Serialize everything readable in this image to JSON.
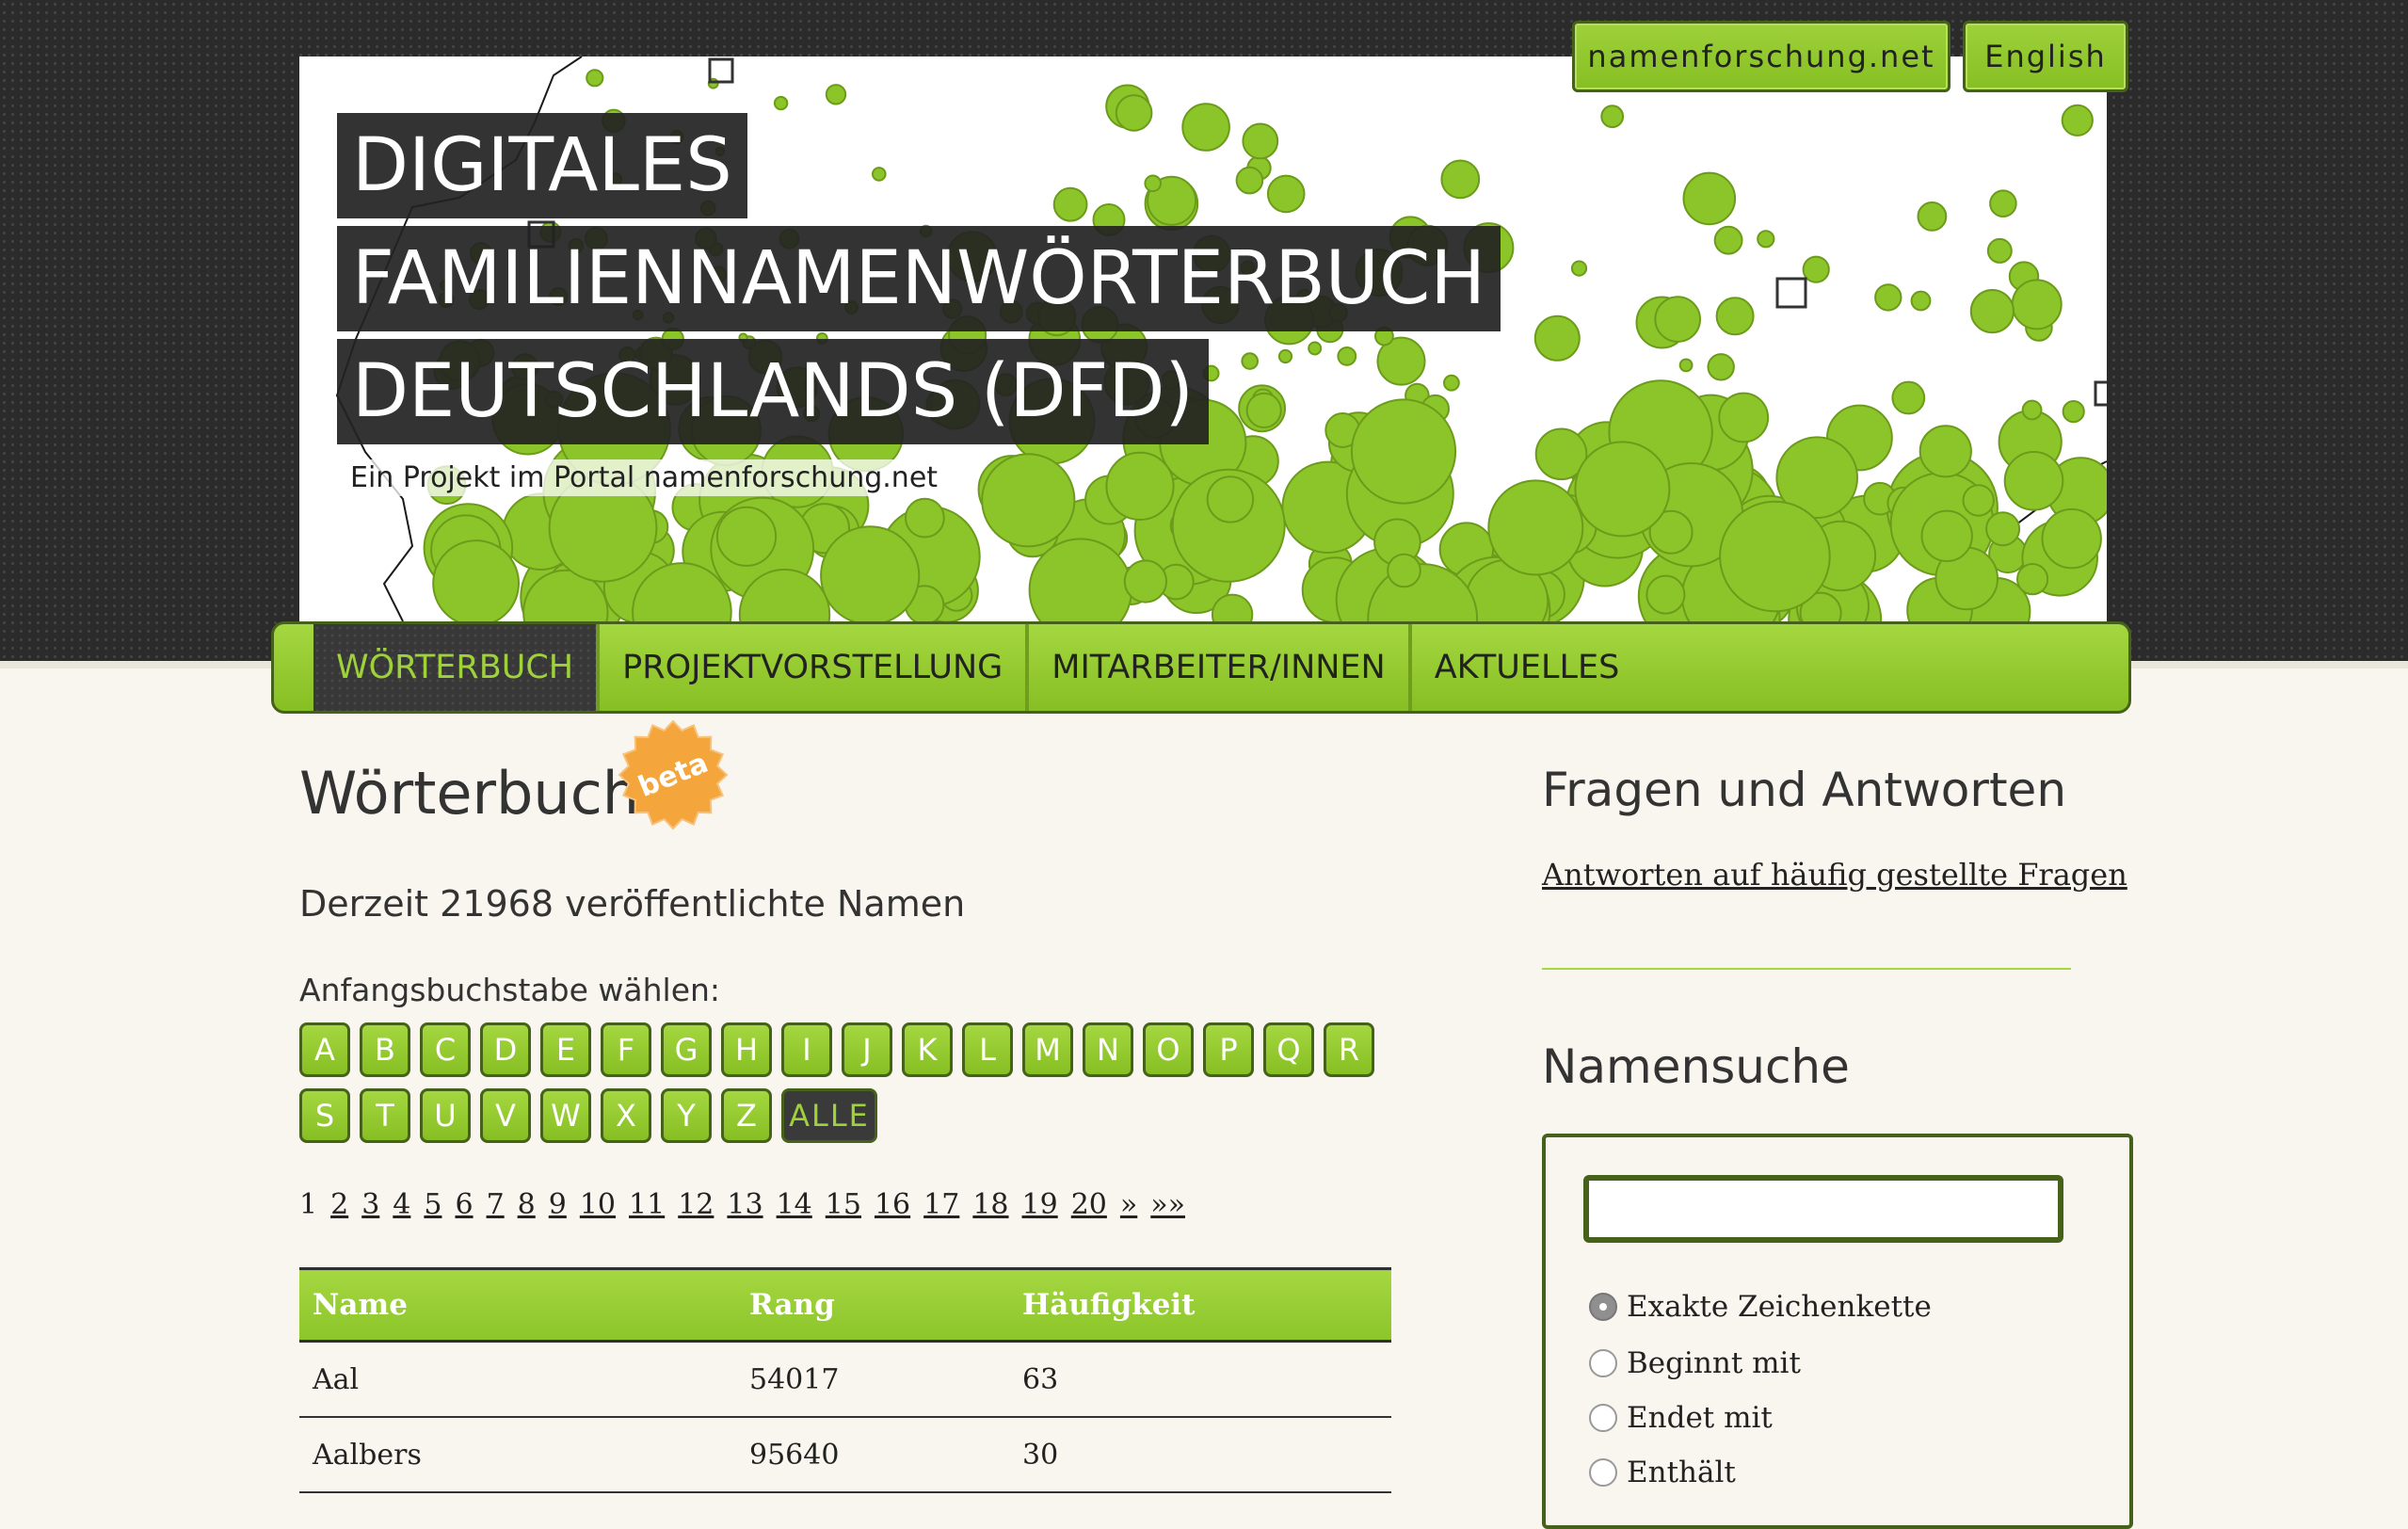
{
  "header": {
    "portal_link": "namenforschung.net",
    "language_link": "English"
  },
  "banner": {
    "title_lines": [
      "DIGITALES",
      "FAMILIENNAMENWÖRTERBUCH",
      "DEUTSCHLANDS (DFD)"
    ],
    "subtitle": "Ein Projekt im Portal namenforschung.net"
  },
  "nav": {
    "items": [
      {
        "label": "WÖRTERBUCH",
        "active": true
      },
      {
        "label": "PROJEKTVORSTELLUNG",
        "active": false
      },
      {
        "label": "MITARBEITER/INNEN",
        "active": false
      },
      {
        "label": "AKTUELLES",
        "active": false
      }
    ]
  },
  "main": {
    "title": "Wörterbuch",
    "badge": "beta",
    "count_text": "Derzeit 21968 veröffentlichte Namen",
    "letters_label": "Anfangsbuchstabe wählen:",
    "letters": [
      "A",
      "B",
      "C",
      "D",
      "E",
      "F",
      "G",
      "H",
      "I",
      "J",
      "K",
      "L",
      "M",
      "N",
      "O",
      "P",
      "Q",
      "R",
      "S",
      "T",
      "U",
      "V",
      "W",
      "X",
      "Y",
      "Z",
      "ALLE"
    ],
    "active_letter": "ALLE",
    "pagination": [
      "1",
      "2",
      "3",
      "4",
      "5",
      "6",
      "7",
      "8",
      "9",
      "10",
      "11",
      "12",
      "13",
      "14",
      "15",
      "16",
      "17",
      "18",
      "19",
      "20",
      "»",
      "»»"
    ],
    "current_page": "1",
    "table": {
      "headers": [
        "Name",
        "Rang",
        "Häufigkeit"
      ],
      "rows": [
        [
          "Aal",
          "54017",
          "63"
        ],
        [
          "Aalbers",
          "95640",
          "30"
        ]
      ]
    }
  },
  "sidebar": {
    "faq_heading": "Fragen und Antworten",
    "faq_link": "Antworten auf häufig gestellte Fragen",
    "search_heading": "Namensuche",
    "search_value": "",
    "search_options": [
      {
        "label": "Exakte Zeichenkette",
        "checked": true
      },
      {
        "label": "Beginnt mit",
        "checked": false
      },
      {
        "label": "Endet mit",
        "checked": false
      },
      {
        "label": "Enthält",
        "checked": false
      }
    ]
  },
  "colors": {
    "accent_green": "#8cc52a",
    "dark_green_border": "#46611a",
    "dark_bg": "#2b2b2b",
    "page_bg": "#f8f6ee"
  }
}
